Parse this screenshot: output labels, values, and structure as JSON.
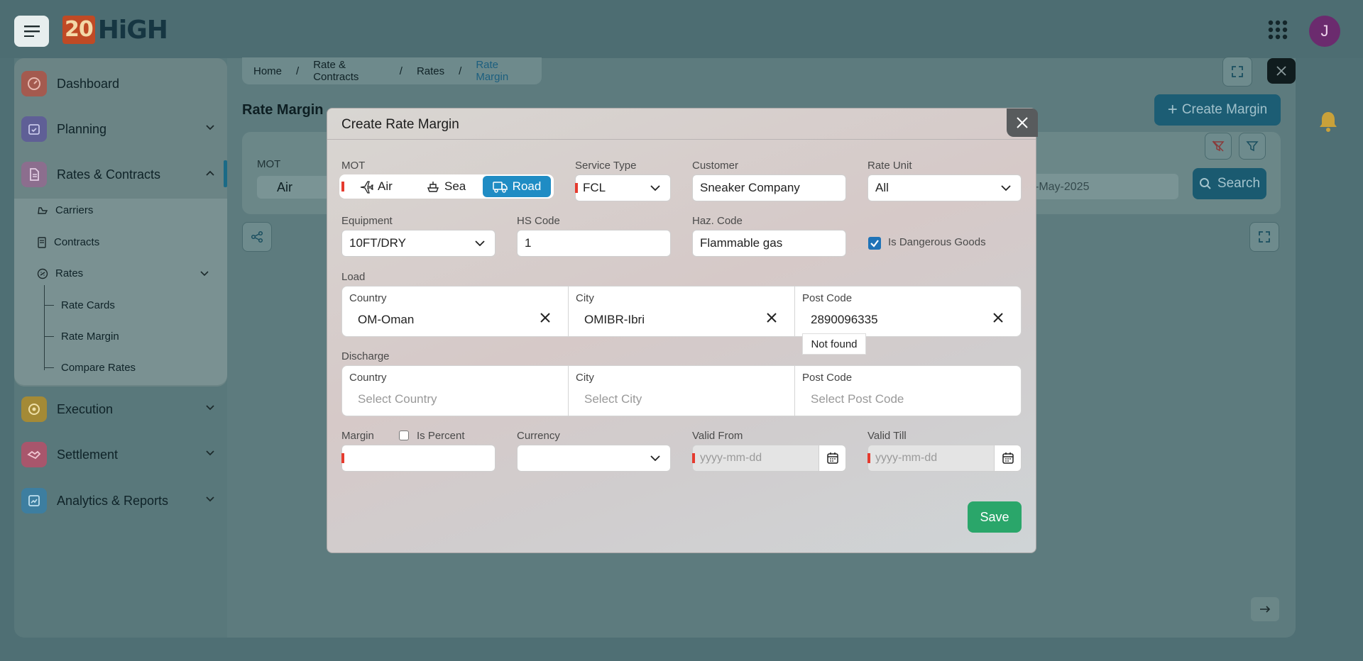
{
  "app": {
    "logo_number": "20",
    "logo_text": "HiGH",
    "avatar_initial": "J"
  },
  "sidebar": {
    "items": [
      {
        "label": "Dashboard"
      },
      {
        "label": "Planning"
      },
      {
        "label": "Rates & Contracts"
      },
      {
        "label": "Execution"
      },
      {
        "label": "Settlement"
      },
      {
        "label": "Analytics & Reports"
      }
    ],
    "sub_items": [
      "Carriers",
      "Contracts",
      "Rates"
    ],
    "rates_children": [
      "Rate Cards",
      "Rate Margin",
      "Compare Rates"
    ]
  },
  "breadcrumb": [
    "Home",
    "/",
    "Rate & Contracts",
    "/",
    "Rates",
    "/",
    "Rate Margin"
  ],
  "page": {
    "title": "Rate Margin",
    "create_button": "Create Margin",
    "search_button": "Search",
    "mot_label": "MOT",
    "mot_value": "Air",
    "date_value": "-May-2025"
  },
  "modal": {
    "title": "Create Rate Margin",
    "mot": {
      "label": "MOT",
      "options": [
        "Air",
        "Sea",
        "Road"
      ],
      "selected": "Road"
    },
    "service_type": {
      "label": "Service Type",
      "value": "FCL"
    },
    "customer": {
      "label": "Customer",
      "value": "Sneaker Company"
    },
    "rate_unit": {
      "label": "Rate Unit",
      "value": "All"
    },
    "equipment": {
      "label": "Equipment",
      "value": "10FT/DRY"
    },
    "hs_code": {
      "label": "HS Code",
      "value": "1"
    },
    "haz_code": {
      "label": "Haz. Code",
      "value": "Flammable gas"
    },
    "dangerous": {
      "label": "Is Dangerous Goods",
      "checked": true
    },
    "load": {
      "label": "Load",
      "country": {
        "label": "Country",
        "value": "OM-Oman"
      },
      "city": {
        "label": "City",
        "value": "OMIBR-Ibri"
      },
      "post_code": {
        "label": "Post Code",
        "value": "2890096335"
      },
      "tooltip": "Not found"
    },
    "discharge": {
      "label": "Discharge",
      "country": {
        "label": "Country",
        "placeholder": "Select Country"
      },
      "city": {
        "label": "City",
        "placeholder": "Select City"
      },
      "post_code": {
        "label": "Post Code",
        "placeholder": "Select Post Code"
      }
    },
    "margin": {
      "label": "Margin",
      "value": ""
    },
    "is_percent": {
      "label": "Is Percent",
      "checked": false
    },
    "currency": {
      "label": "Currency",
      "value": ""
    },
    "valid_from": {
      "label": "Valid From",
      "placeholder": "yyyy-mm-dd"
    },
    "valid_till": {
      "label": "Valid Till",
      "placeholder": "yyyy-mm-dd"
    },
    "save_button": "Save"
  },
  "colors": {
    "accent": "#1f8cc4",
    "save": "#2aa66a",
    "required": "#e53b2f"
  }
}
